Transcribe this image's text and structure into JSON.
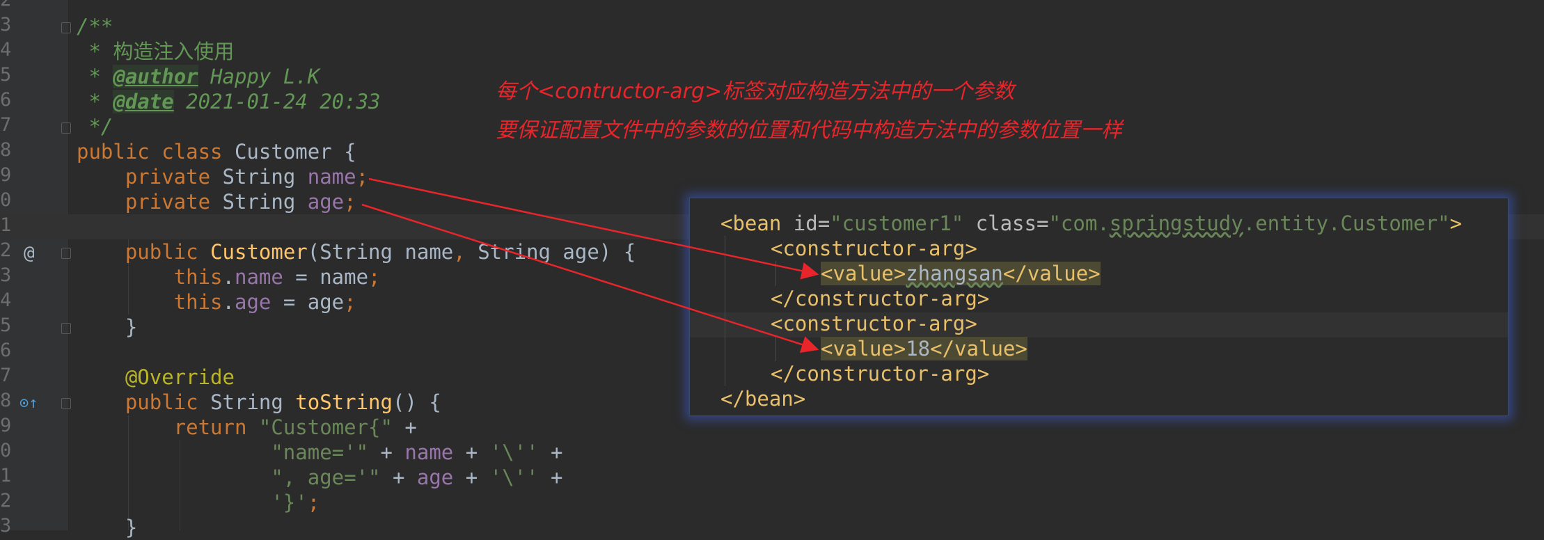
{
  "line_numbers": [
    "2",
    "3",
    "4",
    "5",
    "6",
    "7",
    "8",
    "9",
    "0",
    "1",
    "2",
    "3",
    "4",
    "5",
    "6",
    "7",
    "8",
    "9",
    "0",
    "1",
    "2",
    "3"
  ],
  "code": {
    "l3_comment_open": "/**",
    "l4_comment": " * 构造注入使用",
    "l5_star": " * ",
    "l5_tag": "@author",
    "l5_text": " Happy L.K",
    "l6_star": " * ",
    "l6_tag": "@date",
    "l6_text": " 2021-01-24 20:33",
    "l7_comment_close": " */",
    "l8_public": "public class",
    "l8_name": " Customer {",
    "l9_kw": "    private",
    "l9_type": " String ",
    "l9_field": "name",
    "l9_semi": ";",
    "l10_kw": "    private",
    "l10_type": " String ",
    "l10_field": "age",
    "l10_semi": ";",
    "l12_kw": "    public",
    "l12_ctor": " Customer",
    "l12_params_a": "(String name",
    "l12_comma": ",",
    "l12_params_b": " String age) {",
    "l13_this": "        this",
    "l13_dot": ".",
    "l13_field": "name",
    "l13_rest": " = name",
    "l13_semi": ";",
    "l14_this": "        this",
    "l14_dot": ".",
    "l14_field": "age",
    "l14_rest": " = age",
    "l14_semi": ";",
    "l15_close": "    }",
    "l17_annotation": "    @Override",
    "l18_kw": "    public",
    "l18_type": " String ",
    "l18_fn": "toString",
    "l18_rest": "() {",
    "l19_kw": "        return",
    "l19_str": " \"Customer{\"",
    "l19_plus": " +",
    "l20_str": "                \"name='\"",
    "l20_p1": " + ",
    "l20_field": "name",
    "l20_p2": " + ",
    "l20_chr": "'\\''",
    "l20_p3": " +",
    "l21_str": "                \", age='\"",
    "l21_p1": " + ",
    "l21_field": "age",
    "l21_p2": " + ",
    "l21_chr": "'\\''",
    "l21_p3": " +",
    "l22_chr": "                '}'",
    "l22_semi": ";",
    "l23_close": "    }"
  },
  "gutter_icons": {
    "at_symbol": "@",
    "override_marker": "⊙↑"
  },
  "annotations": {
    "line1_a": "每个",
    "line1_tag": "<contructor-arg>",
    "line1_b": "标签对应构造方法中的一个参数",
    "line2": "要保证配置文件中的参数的位置和代码中构造方法中的参数位置一样"
  },
  "xml": {
    "bean_open_a": "<bean",
    "bean_id_attr": " id=",
    "bean_id_val": "\"customer1\"",
    "bean_class_attr": " class=",
    "bean_class_val_a": "\"com.",
    "bean_class_val_b": "springstudy",
    "bean_class_val_c": ".entity.Customer\"",
    "bean_open_close": ">",
    "ctor_open": "<constructor-arg>",
    "value_open": "<value>",
    "value1": "zhangsan",
    "value_close": "</value>",
    "ctor_close": "</constructor-arg>",
    "value2": "18",
    "bean_close": "</bean>"
  },
  "colors": {
    "background": "#2b2b2b",
    "keyword": "#cc7832",
    "field": "#9876aa",
    "string": "#6a8759",
    "comment": "#629755",
    "annotation": "#bbb529",
    "xml_tag": "#e8bf6a",
    "note_red": "#e8252a",
    "popup_glow": "#3c5ac8"
  }
}
